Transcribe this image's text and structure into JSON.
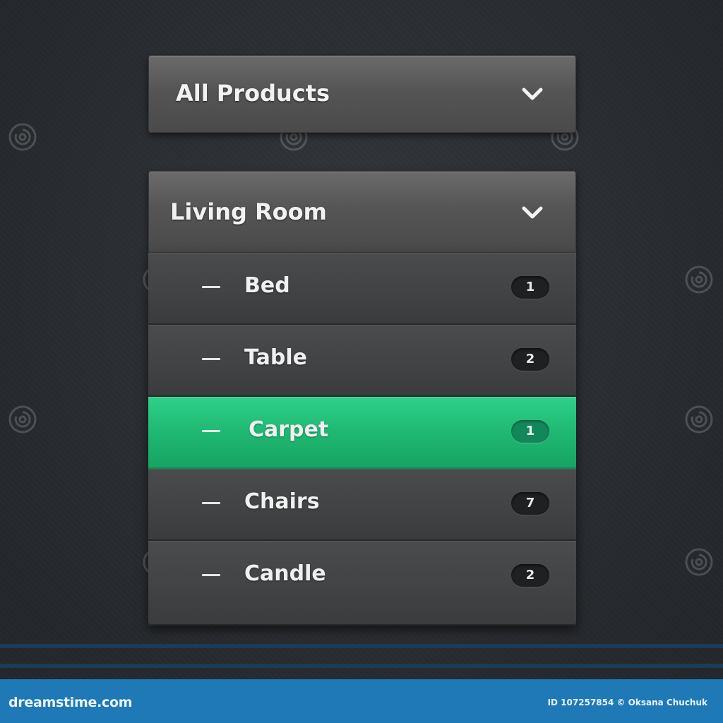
{
  "dropdowns": {
    "all_products": {
      "label": "All Products",
      "icon": "chevron-down-icon"
    },
    "living_room": {
      "label": "Living Room",
      "icon": "chevron-down-icon"
    }
  },
  "items": [
    {
      "label": "Bed",
      "count": "1",
      "active": false
    },
    {
      "label": "Table",
      "count": "2",
      "active": false
    },
    {
      "label": "Carpet",
      "count": "1",
      "active": true
    },
    {
      "label": "Chairs",
      "count": "7",
      "active": false
    },
    {
      "label": "Candle",
      "count": "2",
      "active": false
    }
  ],
  "footer": {
    "brand": "dreamstime.com",
    "credit": "ID 107257854 © Oksana Chuchuk"
  },
  "colors": {
    "background": "#2a2d31",
    "panel": "#555555",
    "active_item": "#1fb872",
    "footer": "#1e79b6"
  }
}
